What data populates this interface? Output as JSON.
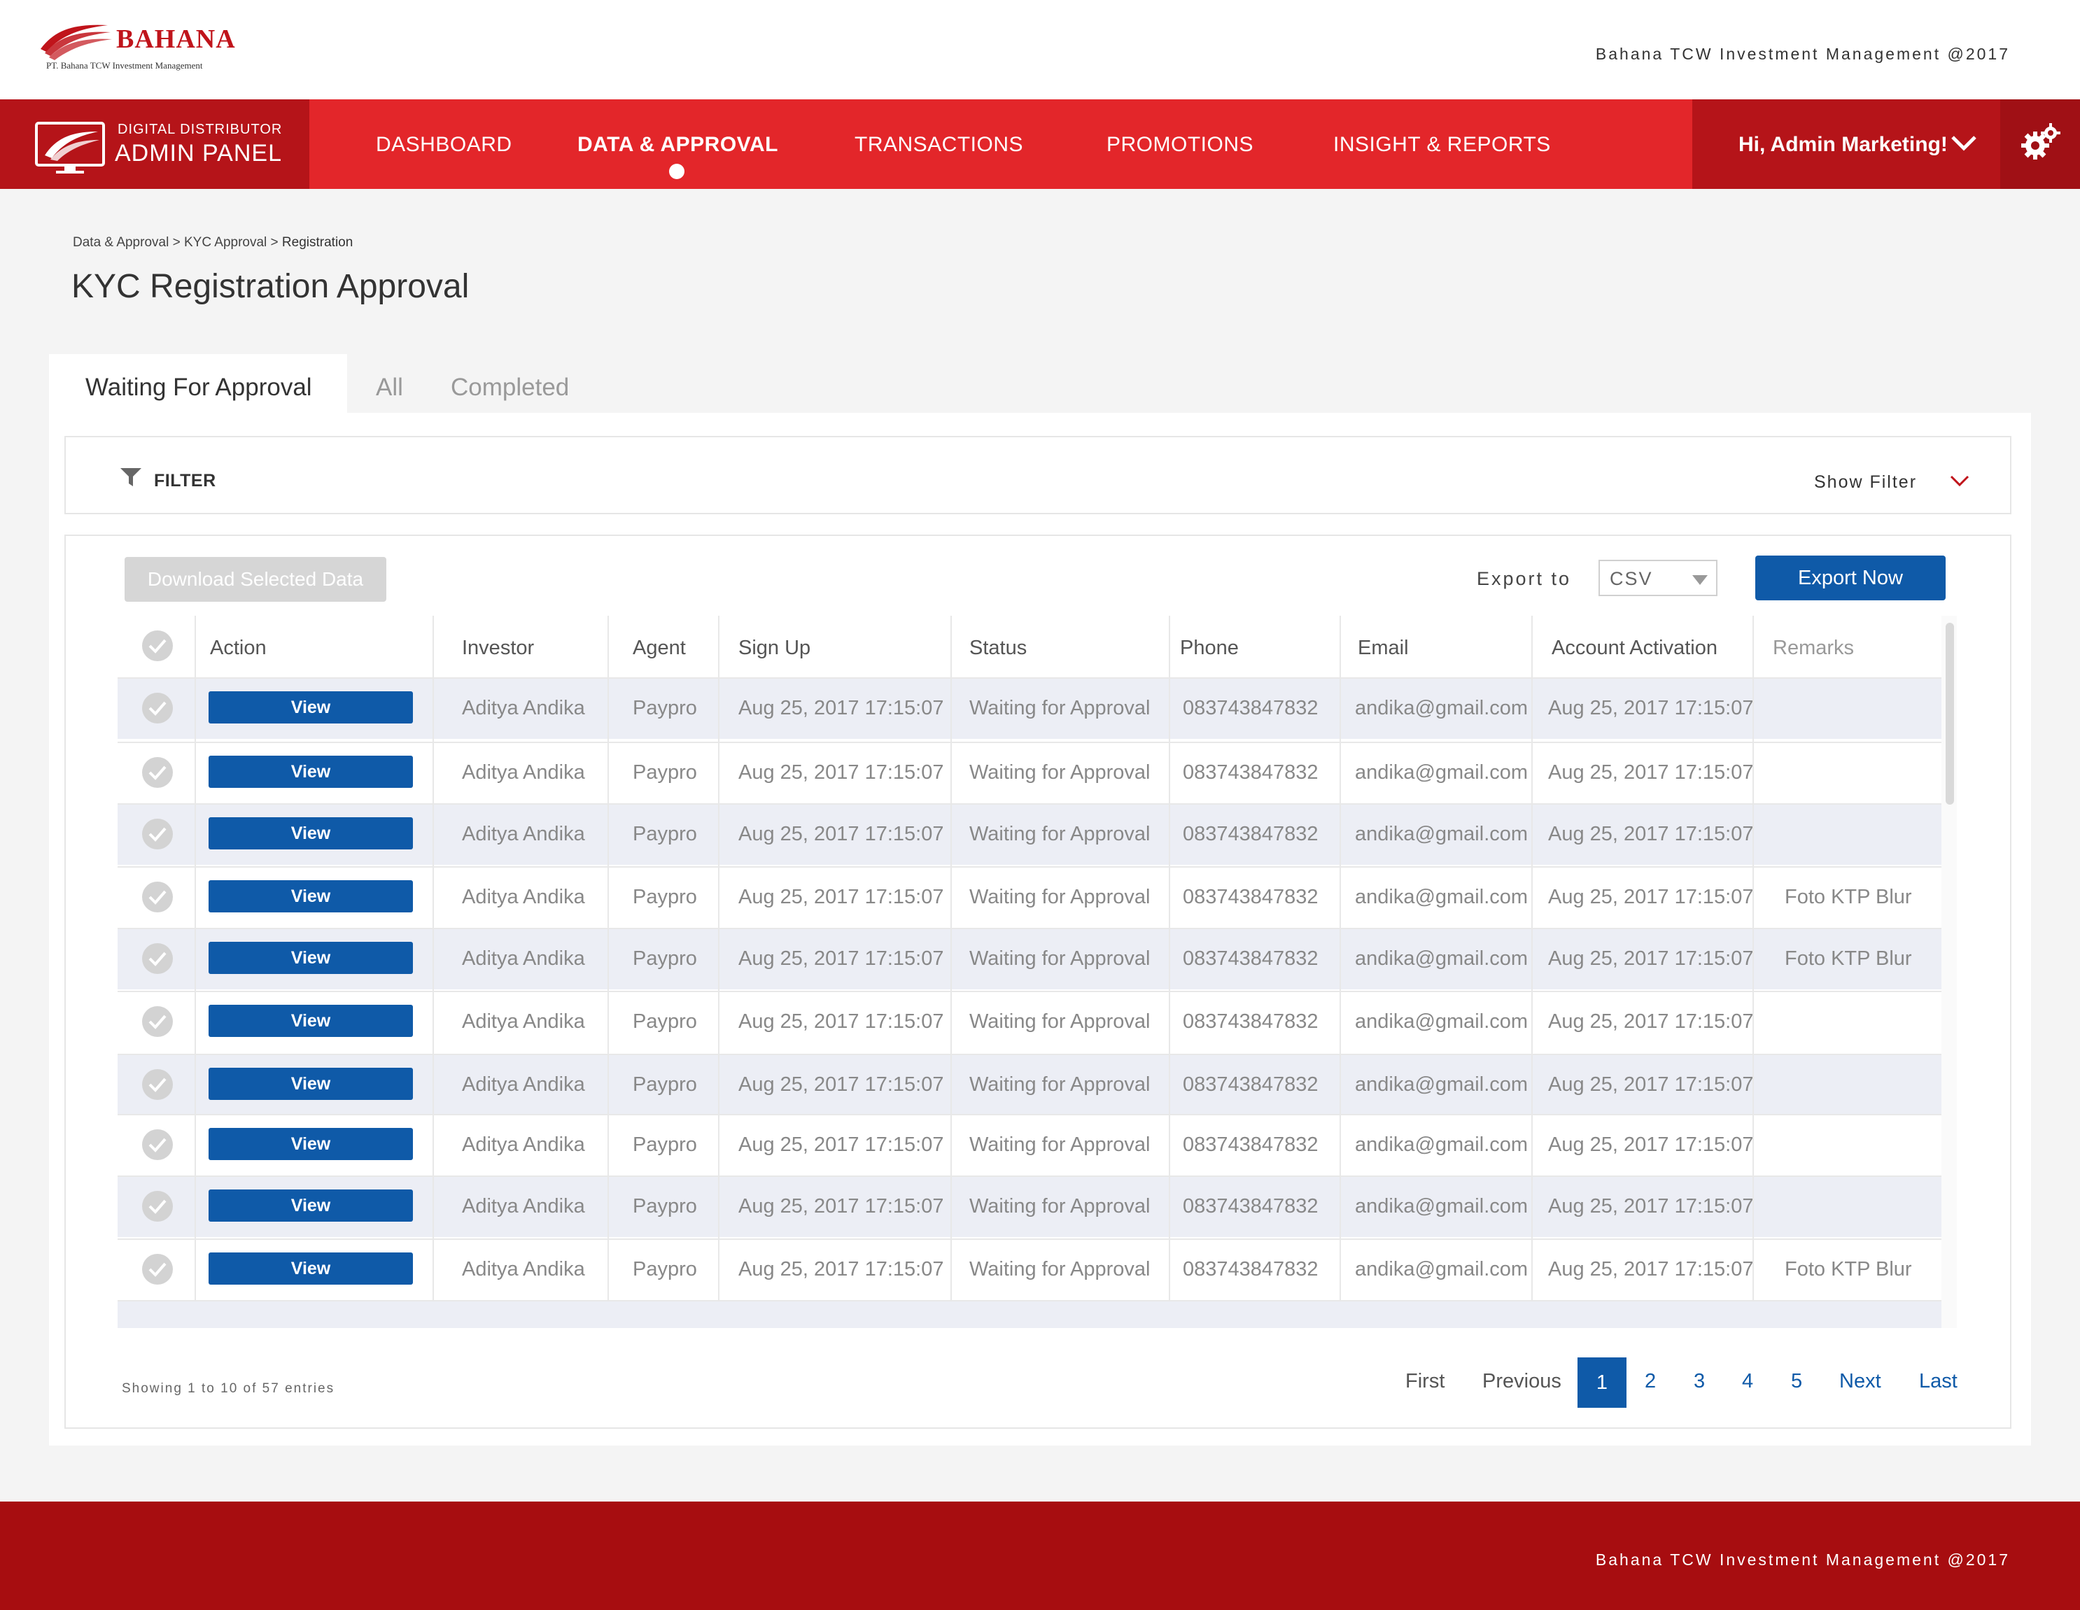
{
  "header": {
    "logo_name": "BAHANA",
    "logo_sub": "PT. Bahana TCW Investment Management",
    "copyright": "Bahana TCW Investment Management @2017"
  },
  "nav": {
    "brand_sub": "DIGITAL DISTRIBUTOR",
    "brand_title": "ADMIN PANEL",
    "items": [
      {
        "label": "DASHBOARD"
      },
      {
        "label": "DATA & APPROVAL"
      },
      {
        "label": "TRANSACTIONS"
      },
      {
        "label": "PROMOTIONS"
      },
      {
        "label": "INSIGHT & REPORTS"
      }
    ],
    "active_item": "DATA & APPROVAL",
    "user_greeting": "Hi, Admin Marketing!"
  },
  "breadcrumb": {
    "level1": "Data & Approval",
    "level2": "KYC Approval",
    "current": "Registration",
    "separator": " > "
  },
  "page_title": "KYC Registration Approval",
  "tabs": [
    {
      "label": "Waiting For Approval"
    },
    {
      "label": "All"
    },
    {
      "label": "Completed"
    }
  ],
  "active_tab": "Waiting For Approval",
  "filter": {
    "label": "FILTER",
    "toggle_label": "Show Filter"
  },
  "toolbar": {
    "download_label": "Download Selected Data",
    "export_label": "Export to",
    "export_format": "CSV",
    "export_button": "Export Now"
  },
  "table": {
    "columns": [
      "Action",
      "Investor",
      "Agent",
      "Sign Up",
      "Status",
      "Phone",
      "Email",
      "Account Activation",
      "Remarks"
    ],
    "view_label": "View",
    "rows": [
      {
        "investor": "Aditya Andika",
        "agent": "Paypro",
        "signup": "Aug 25, 2017 17:15:07",
        "status": "Waiting for Approval",
        "phone": "083743847832",
        "email": "andika@gmail.com",
        "activation": "Aug 25, 2017 17:15:07",
        "remarks": ""
      },
      {
        "investor": "Aditya Andika",
        "agent": "Paypro",
        "signup": "Aug 25, 2017 17:15:07",
        "status": "Waiting for Approval",
        "phone": "083743847832",
        "email": "andika@gmail.com",
        "activation": "Aug 25, 2017 17:15:07",
        "remarks": ""
      },
      {
        "investor": "Aditya Andika",
        "agent": "Paypro",
        "signup": "Aug 25, 2017 17:15:07",
        "status": "Waiting for Approval",
        "phone": "083743847832",
        "email": "andika@gmail.com",
        "activation": "Aug 25, 2017 17:15:07",
        "remarks": ""
      },
      {
        "investor": "Aditya Andika",
        "agent": "Paypro",
        "signup": "Aug 25, 2017 17:15:07",
        "status": "Waiting for Approval",
        "phone": "083743847832",
        "email": "andika@gmail.com",
        "activation": "Aug 25, 2017 17:15:07",
        "remarks": "Foto KTP Blur"
      },
      {
        "investor": "Aditya Andika",
        "agent": "Paypro",
        "signup": "Aug 25, 2017 17:15:07",
        "status": "Waiting for Approval",
        "phone": "083743847832",
        "email": "andika@gmail.com",
        "activation": "Aug 25, 2017 17:15:07",
        "remarks": "Foto KTP Blur"
      },
      {
        "investor": "Aditya Andika",
        "agent": "Paypro",
        "signup": "Aug 25, 2017 17:15:07",
        "status": "Waiting for Approval",
        "phone": "083743847832",
        "email": "andika@gmail.com",
        "activation": "Aug 25, 2017 17:15:07",
        "remarks": ""
      },
      {
        "investor": "Aditya Andika",
        "agent": "Paypro",
        "signup": "Aug 25, 2017 17:15:07",
        "status": "Waiting for Approval",
        "phone": "083743847832",
        "email": "andika@gmail.com",
        "activation": "Aug 25, 2017 17:15:07",
        "remarks": ""
      },
      {
        "investor": "Aditya Andika",
        "agent": "Paypro",
        "signup": "Aug 25, 2017 17:15:07",
        "status": "Waiting for Approval",
        "phone": "083743847832",
        "email": "andika@gmail.com",
        "activation": "Aug 25, 2017 17:15:07",
        "remarks": ""
      },
      {
        "investor": "Aditya Andika",
        "agent": "Paypro",
        "signup": "Aug 25, 2017 17:15:07",
        "status": "Waiting for Approval",
        "phone": "083743847832",
        "email": "andika@gmail.com",
        "activation": "Aug 25, 2017 17:15:07",
        "remarks": ""
      },
      {
        "investor": "Aditya Andika",
        "agent": "Paypro",
        "signup": "Aug 25, 2017 17:15:07",
        "status": "Waiting for Approval",
        "phone": "083743847832",
        "email": "andika@gmail.com",
        "activation": "Aug 25, 2017 17:15:07",
        "remarks": "Foto KTP Blur"
      }
    ]
  },
  "pagination": {
    "showing": "Showing 1 to 10 of 57 entries",
    "first": "First",
    "previous": "Previous",
    "pages": [
      "1",
      "2",
      "3",
      "4",
      "5"
    ],
    "current_page": "1",
    "next": "Next",
    "last": "Last"
  },
  "footer": {
    "copyright": "Bahana TCW Investment Management @2017"
  },
  "colors": {
    "brand_red": "#e3262a",
    "brand_dark_red": "#b51419",
    "footer_red": "#a70d10",
    "primary_blue": "#0f5aa8",
    "row_alt": "#eceef5"
  },
  "icons": [
    "bahana-logo-icon",
    "admin-panel-icon",
    "chevron-down-icon",
    "gear-icon",
    "filter-icon",
    "check-circle-icon",
    "caret-down-icon"
  ]
}
